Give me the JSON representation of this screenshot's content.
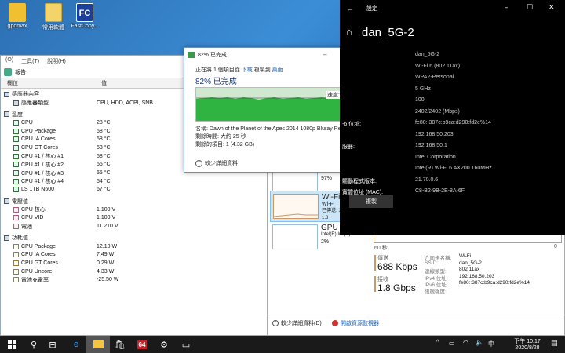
{
  "desktop": {
    "icons": [
      {
        "label": "gpdmax",
        "color": "#f0c030"
      },
      {
        "label": "常用軟體",
        "color": "#f5d36b"
      },
      {
        "label": "FastCopy...",
        "color": "#1c3f9a",
        "glyph": "FC"
      }
    ]
  },
  "hwinfo": {
    "menu": [
      "(O)",
      "工具(T)",
      "說明(H)"
    ],
    "toolbar_label": "報告",
    "col_name": "欄位",
    "col_value": "值",
    "groups": [
      {
        "title": "感應器內容",
        "rows": [
          {
            "name": "感應器類型",
            "value": "CPU, HDD, ACPI, SNB"
          }
        ]
      },
      {
        "title": "溫度",
        "rows": [
          {
            "name": "CPU",
            "value": "28 °C"
          },
          {
            "name": "CPU Package",
            "value": "58 °C"
          },
          {
            "name": "CPU IA Cores",
            "value": "58 °C"
          },
          {
            "name": "CPU GT Cores",
            "value": "53 °C"
          },
          {
            "name": "CPU #1 / 核心 #1",
            "value": "58 °C"
          },
          {
            "name": "CPU #1 / 核心 #2",
            "value": "55 °C"
          },
          {
            "name": "CPU #1 / 核心 #3",
            "value": "55 °C"
          },
          {
            "name": "CPU #1 / 核心 #4",
            "value": "54 °C"
          },
          {
            "name": "LS 1TB N600",
            "value": "67 °C"
          }
        ]
      },
      {
        "title": "電壓值",
        "rows": [
          {
            "name": "CPU 核心",
            "value": "1.100 V"
          },
          {
            "name": "CPU VID",
            "value": "1.100 V"
          },
          {
            "name": "電池",
            "value": "11.210 V"
          }
        ]
      },
      {
        "title": "功耗值",
        "rows": [
          {
            "name": "CPU Package",
            "value": "12.10 W"
          },
          {
            "name": "CPU IA Cores",
            "value": "7.49 W"
          },
          {
            "name": "CPU GT Cores",
            "value": "0.29 W"
          },
          {
            "name": "CPU Uncore",
            "value": "4.33 W"
          },
          {
            "name": "電池充電率",
            "value": "-25.50 W"
          }
        ]
      }
    ]
  },
  "copy": {
    "title": "82% 已完成",
    "status_prefix": "正在將 1 個項目從",
    "status_src": "下載",
    "status_mid": "複製到",
    "status_dst": "桌面",
    "percent_text": "82% 已完成",
    "progress": 0.82,
    "speed": "速度: 217 MB/秒",
    "name_line": "名稱: Dawn of the Planet of the Apes 2014 1080p Bluray Remux AVC ...",
    "time_line": "剩餘時間: 大約 25 秒",
    "items_line": "剩餘的項目: 1 (4.32 GB)",
    "less_details": "較少詳細資料"
  },
  "taskmgr": {
    "sidebar": [
      {
        "title": "SSD",
        "sub": "",
        "val": "97%"
      },
      {
        "title": "Wi-Fi",
        "sub": "Wi-Fi",
        "val": "已傳送: 160 已接收: 1.8"
      },
      {
        "title": "GPU 0",
        "sub": "Intel(R) Iris(R) Plus",
        "val": "2%"
      }
    ],
    "axis_left": "60 秒",
    "axis_right": "0",
    "send_label": "傳送",
    "send_value": "688 Kbps",
    "recv_label": "接收",
    "recv_value": "1.8 Gbps",
    "details": [
      {
        "k": "介面卡名稱:",
        "v": "Wi-Fi"
      },
      {
        "k": "SSID:",
        "v": "dan_5G-2"
      },
      {
        "k": "連線類型:",
        "v": "802.11ax"
      },
      {
        "k": "IPv4 位址:",
        "v": "192.168.50.203"
      },
      {
        "k": "IPv6 位址:",
        "v": "fe80::387c:b9ca:d290:fd2e%14"
      },
      {
        "k": "訊號強度:",
        "v": ""
      }
    ],
    "fewer_details": "較少詳細資料(D)",
    "open_monitor": "開啟資源監視器"
  },
  "wifi": {
    "window_title": "設定",
    "heading": "dan_5G-2",
    "props": [
      {
        "k": "",
        "v": "dan_5G-2"
      },
      {
        "k": "",
        "v": "Wi-Fi 6 (802.11ax)"
      },
      {
        "k": "",
        "v": "WPA2-Personal"
      },
      {
        "k": "",
        "v": "5 GHz"
      },
      {
        "k": "",
        "v": "100"
      },
      {
        "k": "",
        "v": "2402/2402 (Mbps)"
      },
      {
        "k": "-6 位址:",
        "v": "fe80::387c:b9ca:d290:fd2e%14"
      },
      {
        "k": "",
        "v": "192.168.50.203"
      },
      {
        "k": "服器:",
        "v": "192.168.50.1"
      },
      {
        "k": "",
        "v": "Intel Corporation"
      },
      {
        "k": "",
        "v": "Intel(R) Wi-Fi 6 AX200 160MHz"
      },
      {
        "k": "驅動程式版本:",
        "v": "21.70.0.6"
      },
      {
        "k": "實體位址 (MAC):",
        "v": "C8-B2-9B-2E-8A-6F"
      }
    ],
    "copy_button": "複製"
  },
  "taskbar": {
    "time": "下午 10:17",
    "date": "2020/8/28",
    "lang": "中",
    "app64": "64"
  }
}
